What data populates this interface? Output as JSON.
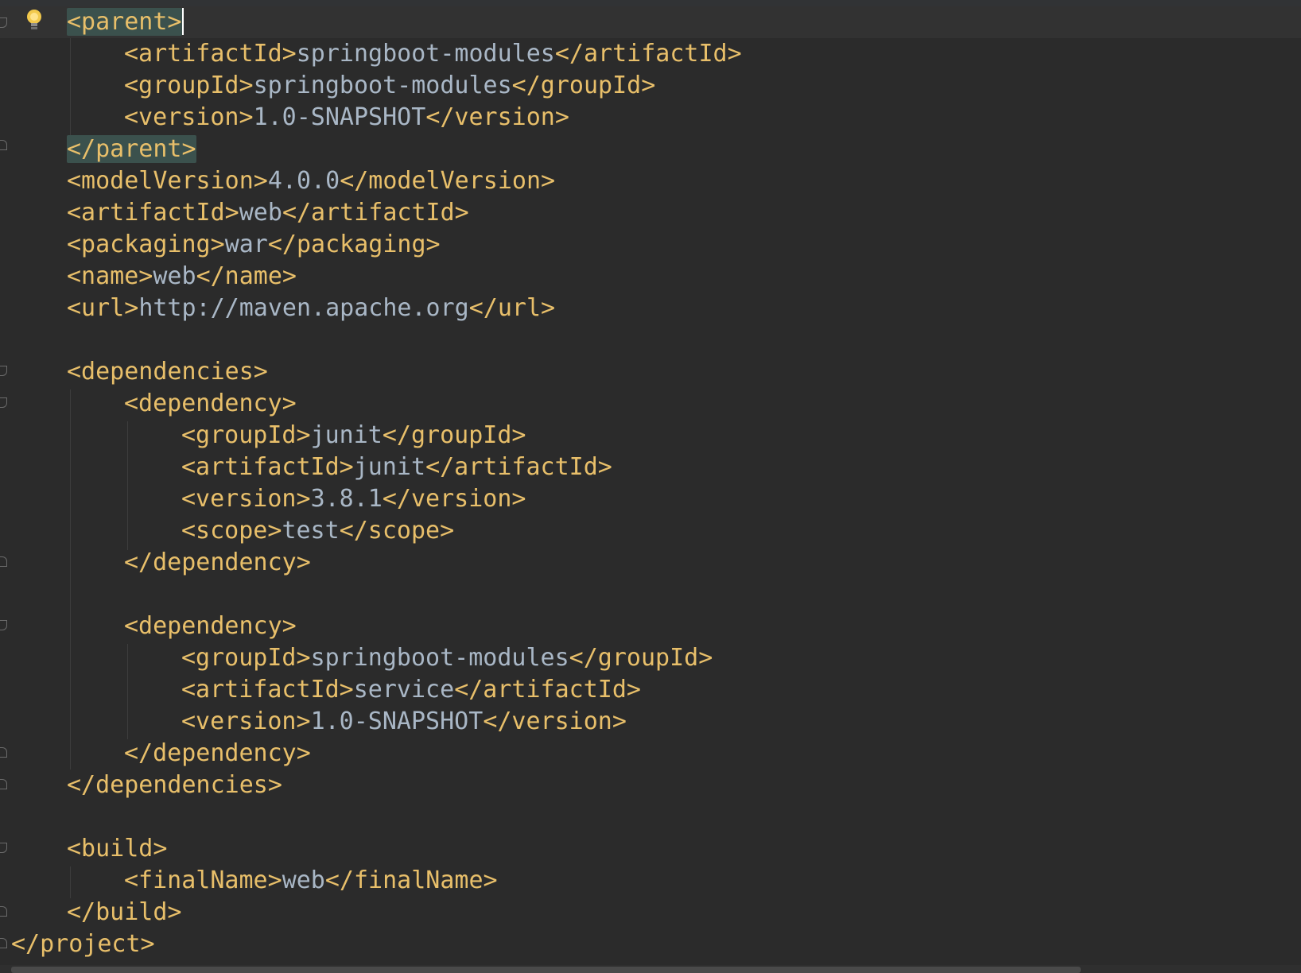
{
  "editor": {
    "lines": [
      {
        "id": "l01",
        "open": "<parent>",
        "value": "",
        "close": ""
      },
      {
        "id": "l02",
        "open": "<artifactId>",
        "value": "springboot-modules",
        "close": "</artifactId>"
      },
      {
        "id": "l03",
        "open": "<groupId>",
        "value": "springboot-modules",
        "close": "</groupId>"
      },
      {
        "id": "l04",
        "open": "<version>",
        "value": "1.0-SNAPSHOT",
        "close": "</version>"
      },
      {
        "id": "l05",
        "open": "</parent>",
        "value": "",
        "close": ""
      },
      {
        "id": "l06",
        "open": "<modelVersion>",
        "value": "4.0.0",
        "close": "</modelVersion>"
      },
      {
        "id": "l07",
        "open": "<artifactId>",
        "value": "web",
        "close": "</artifactId>"
      },
      {
        "id": "l08",
        "open": "<packaging>",
        "value": "war",
        "close": "</packaging>"
      },
      {
        "id": "l09",
        "open": "<name>",
        "value": "web",
        "close": "</name>"
      },
      {
        "id": "l10",
        "open": "<url>",
        "value": "http://maven.apache.org",
        "close": "</url>"
      },
      {
        "id": "l12",
        "open": "<dependencies>",
        "value": "",
        "close": ""
      },
      {
        "id": "l13",
        "open": "<dependency>",
        "value": "",
        "close": ""
      },
      {
        "id": "l14",
        "open": "<groupId>",
        "value": "junit",
        "close": "</groupId>"
      },
      {
        "id": "l15",
        "open": "<artifactId>",
        "value": "junit",
        "close": "</artifactId>"
      },
      {
        "id": "l16",
        "open": "<version>",
        "value": "3.8.1",
        "close": "</version>"
      },
      {
        "id": "l17",
        "open": "<scope>",
        "value": "test",
        "close": "</scope>"
      },
      {
        "id": "l18",
        "open": "</dependency>",
        "value": "",
        "close": ""
      },
      {
        "id": "l20",
        "open": "<dependency>",
        "value": "",
        "close": ""
      },
      {
        "id": "l21",
        "open": "<groupId>",
        "value": "springboot-modules",
        "close": "</groupId>"
      },
      {
        "id": "l22",
        "open": "<artifactId>",
        "value": "service",
        "close": "</artifactId>"
      },
      {
        "id": "l23",
        "open": "<version>",
        "value": "1.0-SNAPSHOT",
        "close": "</version>"
      },
      {
        "id": "l24",
        "open": "</dependency>",
        "value": "",
        "close": ""
      },
      {
        "id": "l25",
        "open": "</dependencies>",
        "value": "",
        "close": ""
      },
      {
        "id": "l27",
        "open": "<build>",
        "value": "",
        "close": ""
      },
      {
        "id": "l28",
        "open": "<finalName>",
        "value": "web",
        "close": "</finalName>"
      },
      {
        "id": "l29",
        "open": "</build>",
        "value": "",
        "close": ""
      },
      {
        "id": "l30",
        "open": "</project>",
        "value": "",
        "close": ""
      }
    ]
  },
  "colors": {
    "background": "#2b2b2b",
    "tag": "#e8bf6a",
    "text": "#a9b7c6",
    "tag_highlight": "#3b514d"
  },
  "icons": {
    "intention": "lightbulb-icon",
    "fold": "fold-marker-icon"
  }
}
